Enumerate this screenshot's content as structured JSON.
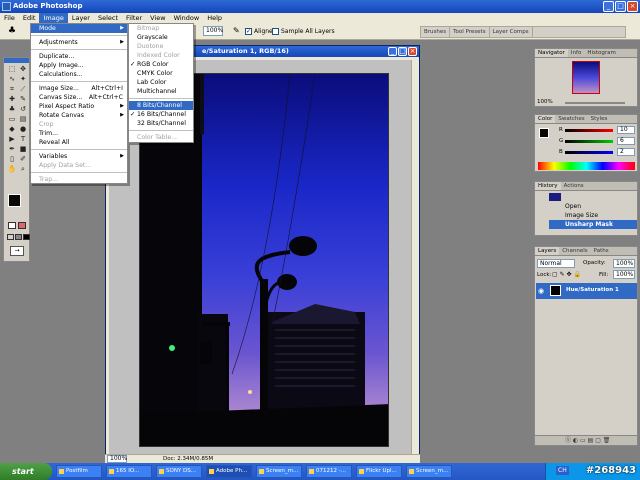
{
  "app": {
    "title": "Adobe Photoshop"
  },
  "menubar": [
    "File",
    "Edit",
    "Image",
    "Layer",
    "Select",
    "Filter",
    "View",
    "Window",
    "Help"
  ],
  "options": {
    "zoom": "100%",
    "aligned": "Aligned",
    "sample_all_layers": "Sample All Layers"
  },
  "palette_well": [
    "Brushes",
    "Tool Presets",
    "Layer Comps"
  ],
  "image_menu": [
    {
      "label": "Mode",
      "submenu": true,
      "highlight": true
    },
    {
      "sep": true
    },
    {
      "label": "Adjustments",
      "submenu": true
    },
    {
      "sep": true
    },
    {
      "label": "Duplicate..."
    },
    {
      "label": "Apply Image..."
    },
    {
      "label": "Calculations..."
    },
    {
      "sep": true
    },
    {
      "label": "Image Size...",
      "shortcut": "Alt+Ctrl+I"
    },
    {
      "label": "Canvas Size...",
      "shortcut": "Alt+Ctrl+C"
    },
    {
      "label": "Pixel Aspect Ratio",
      "submenu": true
    },
    {
      "label": "Rotate Canvas",
      "submenu": true
    },
    {
      "label": "Crop",
      "disabled": true
    },
    {
      "label": "Trim..."
    },
    {
      "label": "Reveal All"
    },
    {
      "sep": true
    },
    {
      "label": "Variables",
      "submenu": true
    },
    {
      "label": "Apply Data Set...",
      "disabled": true
    },
    {
      "sep": true
    },
    {
      "label": "Trap...",
      "disabled": true
    }
  ],
  "mode_menu": [
    {
      "label": "Bitmap",
      "disabled": true
    },
    {
      "label": "Grayscale"
    },
    {
      "label": "Duotone",
      "disabled": true
    },
    {
      "label": "Indexed Color",
      "disabled": true
    },
    {
      "label": "RGB Color",
      "checked": true
    },
    {
      "label": "CMYK Color"
    },
    {
      "label": "Lab Color"
    },
    {
      "label": "Multichannel"
    },
    {
      "sep": true
    },
    {
      "label": "8 Bits/Channel",
      "highlight": true
    },
    {
      "label": "16 Bits/Channel",
      "checked": true
    },
    {
      "label": "32 Bits/Channel"
    },
    {
      "sep": true
    },
    {
      "label": "Color Table...",
      "disabled": true
    }
  ],
  "document": {
    "title": "e/Saturation 1, RGB/16)",
    "zoom": "100%",
    "doc_size": "Doc: 2.34M/0.85M"
  },
  "navigator": {
    "tabs": [
      "Navigator",
      "Info",
      "Histogram"
    ],
    "zoom": "100%"
  },
  "color_panel": {
    "tabs": [
      "Color",
      "Swatches",
      "Styles"
    ],
    "channels": [
      {
        "label": "R",
        "value": "10"
      },
      {
        "label": "G",
        "value": "6"
      },
      {
        "label": "B",
        "value": "2"
      }
    ]
  },
  "history": {
    "tabs": [
      "History",
      "Actions"
    ],
    "items": [
      "Open",
      "Image Size",
      "Unsharp Mask"
    ]
  },
  "layers": {
    "tabs": [
      "Layers",
      "Channels",
      "Paths"
    ],
    "blend": "Normal",
    "opacity_label": "Opacity:",
    "opacity": "100%",
    "lock_label": "Lock:",
    "fill_label": "Fill:",
    "fill": "100%",
    "layer_name": "Hue/Saturation 1"
  },
  "taskbar": {
    "start": "start",
    "items": [
      "Postfilm",
      "165 IO...",
      "SONY DS...",
      "Adobe Ph...",
      "Screen_m...",
      "071212 -...",
      "Flickr Upl...",
      "Screen_m..."
    ],
    "clock": "CH"
  },
  "watermark": "#268943",
  "colors": {
    "title_blue": "#1546b8",
    "highlight": "#316ac5",
    "chrome": "#ece9d8"
  }
}
